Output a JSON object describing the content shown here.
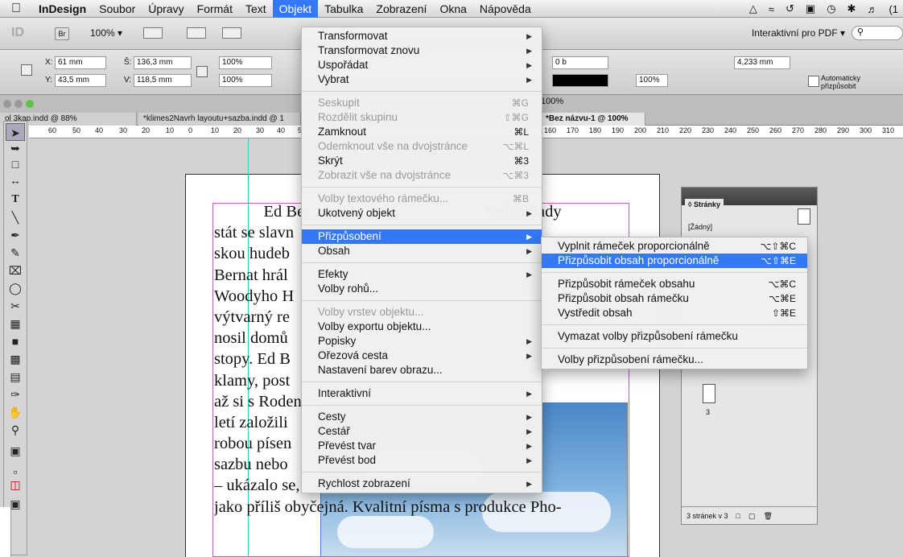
{
  "menubar": {
    "app": "InDesign",
    "items": [
      "Soubor",
      "Úpravy",
      "Formát",
      "Text",
      "Objekt",
      "Tabulka",
      "Zobrazení",
      "Okna",
      "Nápověda"
    ],
    "active": "Objekt",
    "status_extra": "(1"
  },
  "appbar": {
    "bridge": "Br",
    "zoom": "100% ▾",
    "workspace": "Interaktivní pro PDF ▾"
  },
  "control": {
    "x_label": "X:",
    "x_value": "61 mm",
    "y_label": "Y:",
    "y_value": "43,5 mm",
    "w_label": "Š:",
    "w_value": "136,3 mm",
    "h_label": "V:",
    "h_value": "118,5 mm",
    "scale_x": "100%",
    "scale_y": "100%",
    "stroke": "0 b",
    "opacity": "100%",
    "gutter": "4,233 mm",
    "auto_fit": "Automaticky",
    "auto_fit2": "přizpůsobit"
  },
  "tabs": [
    "ol 3kap.indd @ 88%",
    "*klimes2Navrh layoutu+sazba.indd @ 1",
    "*Bez názvu-1 @ 100%"
  ],
  "zoom_label": "100%",
  "ruler_labels": [
    "60",
    "50",
    "40",
    "30",
    "20",
    "10",
    "0",
    "10",
    "20",
    "30",
    "40",
    "50",
    "160",
    "170",
    "180",
    "190",
    "200",
    "210",
    "220",
    "230",
    "240",
    "250",
    "260",
    "270",
    "280",
    "290",
    "300",
    "310"
  ],
  "document_text": [
    "            Ed Ber                                           ředpoklady",
    "stát se slavn",
    "skou hudeb",
    "Bernat hrál",
    "Woodyho H",
    "výtvarný re",
    "nosil domů",
    "stopy. Ed B",
    "klamy, post",
    "až si s Roden",
    "letí založili",
    "robou písen",
    "sazbu nebo",
    "– ukázalo se,",
    "jako příliš obyčejná. Kvalitní písma s produkce Pho-"
  ],
  "pages_panel": {
    "title": "◊ Stránky",
    "none": "[Žádný]",
    "page_num": "3",
    "footer": "3 stránek v 3"
  },
  "objekt_menu": [
    {
      "label": "Transformovat",
      "submenu": true
    },
    {
      "label": "Transformovat znovu",
      "submenu": true
    },
    {
      "label": "Uspořádat",
      "submenu": true
    },
    {
      "label": "Vybrat",
      "submenu": true
    },
    {
      "sep": true
    },
    {
      "label": "Seskupit",
      "shortcut": "⌘G",
      "disabled": true
    },
    {
      "label": "Rozdělit skupinu",
      "shortcut": "⇧⌘G",
      "disabled": true
    },
    {
      "label": "Zamknout",
      "shortcut": "⌘L"
    },
    {
      "label": "Odemknout vše na dvojstránce",
      "shortcut": "⌥⌘L",
      "disabled": true
    },
    {
      "label": "Skrýt",
      "shortcut": "⌘3"
    },
    {
      "label": "Zobrazit vše na dvojstránce",
      "shortcut": "⌥⌘3",
      "disabled": true
    },
    {
      "sep": true
    },
    {
      "label": "Volby textového rámečku...",
      "shortcut": "⌘B",
      "disabled": true
    },
    {
      "label": "Ukotvený objekt",
      "submenu": true
    },
    {
      "sep": true
    },
    {
      "label": "Přizpůsobení",
      "submenu": true,
      "highlighted": true
    },
    {
      "label": "Obsah",
      "submenu": true
    },
    {
      "sep": true
    },
    {
      "label": "Efekty",
      "submenu": true
    },
    {
      "label": "Volby rohů..."
    },
    {
      "sep": true
    },
    {
      "label": "Volby vrstev objektu...",
      "disabled": true
    },
    {
      "label": "Volby exportu objektu..."
    },
    {
      "label": "Popisky",
      "submenu": true
    },
    {
      "label": "Ořezová cesta",
      "submenu": true
    },
    {
      "label": "Nastavení barev obrazu..."
    },
    {
      "sep": true
    },
    {
      "label": "Interaktivní",
      "submenu": true
    },
    {
      "sep": true
    },
    {
      "label": "Cesty",
      "submenu": true
    },
    {
      "label": "Cestář",
      "submenu": true
    },
    {
      "label": "Převést tvar",
      "submenu": true
    },
    {
      "label": "Převést bod",
      "submenu": true
    },
    {
      "sep": true
    },
    {
      "label": "Rychlost zobrazení",
      "submenu": true
    }
  ],
  "fit_submenu": [
    {
      "label": "Vyplnit rámeček proporcionálně",
      "shortcut": "⌥⇧⌘C"
    },
    {
      "label": "Přizpůsobit obsah proporcionálně",
      "shortcut": "⌥⇧⌘E",
      "highlighted": true
    },
    {
      "sep": true
    },
    {
      "label": "Přizpůsobit rámeček obsahu",
      "shortcut": "⌥⌘C"
    },
    {
      "label": "Přizpůsobit obsah rámečku",
      "shortcut": "⌥⌘E"
    },
    {
      "label": "Vystředit obsah",
      "shortcut": "⇧⌘E"
    },
    {
      "sep": true
    },
    {
      "label": "Vymazat volby přizpůsobení rámečku"
    },
    {
      "sep": true
    },
    {
      "label": "Volby přizpůsobení rámečku..."
    }
  ],
  "colors": {
    "highlight": "#3478f6",
    "frame_text": "#c25dc2",
    "guide": "#33cccc"
  }
}
